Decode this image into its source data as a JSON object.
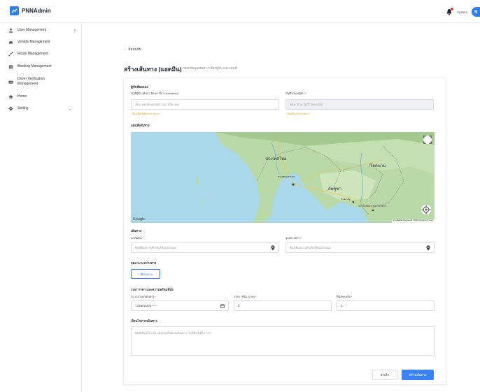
{
  "app": {
    "name": "PNNAdmin",
    "user_name": "System",
    "avatar_letter": "S",
    "brand_color": "#2f80ed"
  },
  "sidebar": {
    "items": [
      {
        "label": "User Management",
        "icon": "user-icon"
      },
      {
        "label": "Vehicle Management",
        "icon": "car-icon"
      },
      {
        "label": "Route Management",
        "icon": "route-icon"
      },
      {
        "label": "Booking Management",
        "icon": "booking-icon"
      },
      {
        "label": "Driver Verification Management",
        "icon": "id-card-icon"
      },
      {
        "label": "Home",
        "icon": "home-icon"
      },
      {
        "label": "Setting",
        "icon": "gear-icon"
      }
    ]
  },
  "main": {
    "back_label": "← ย้อนกลับ",
    "title": "สร้างเส้นทาง (แอดมิน)",
    "subtitle": "กรอกข้อมูลเส้นทาง เลือกผู้ขับ และแผนที่"
  },
  "form": {
    "driver_section": "ผู้ขับที่ผลลอง",
    "driver_label": "บัญชีผู้ขับ (ค้นหา อีเมล / ชื่อ / Username)",
    "driver_placeholder": "เช่น user@example.com หรือ user",
    "driver_hint": "* ต้องเลือกผู้ขับจากรายการ",
    "vehicle_label": "บัญชีรถของผู้ขับ",
    "vehicle_placeholder": "ค้นหาด้วย รุ่น/ป้ายทะเบียน",
    "vehicle_hint": "* ต้องเลือกจากรายการ",
    "map_section": "แผนที่เส้นทาง",
    "route_section": "เส้นทาง",
    "start_label": "จุดเริ่มต้น",
    "start_placeholder": "พิมพ์ชื่อสถานที่ หรือใช้ปุ่มปักหมุด",
    "end_label": "จุดปลายทาง",
    "end_placeholder": "พิมพ์ชื่อสถานที่ หรือใช้ปุ่มปักหมุด",
    "stops_section": "จุดแวะระหว่างทาง",
    "add_stop_label": "+ เพิ่มจุดแวะ",
    "time_section": "เวลา ราคา และความพร้อมที่นั่ง",
    "date_label": "วัน เวลาออกเดินทาง",
    "date_value": "วว/ดด/ปปปป --:--",
    "price_label": "ราคา / ที่นั่ง (บาท)",
    "price_value": "0",
    "seats_label": "ที่นั่งคงเหลือ",
    "seats_value": "1",
    "conditions_section": "เงื่อนไขการเดินทาง",
    "conditions_placeholder": "พิมพ์เงื่อนไข เช่น งดสูบบุหรี่ตลอดเส้นทาง, ไม่มีสัตว์เลี้ยง ฯลฯ",
    "cancel_label": "ยกเลิก",
    "create_label": "สร้างเส้นทาง"
  },
  "map": {
    "google": "Google",
    "attribution": "แป้นพิมพ์ลัด  ข้อมูลแผนที่ ©2025 Google  ข้อกำหนด",
    "labels": {
      "country": "ประเทศไทย",
      "bangkok": "กรุงเทพมหานคร",
      "cambodia": "กัมพูชา",
      "vietnam": "เวียดนาม",
      "phnom_penh": "พนมเปญ",
      "hcm": "นครโฮจิมินห์ Ho Chi Minh"
    }
  },
  "colors": {
    "primary": "#3b82f6",
    "hint": "#e0a000",
    "required": "#e53935"
  }
}
